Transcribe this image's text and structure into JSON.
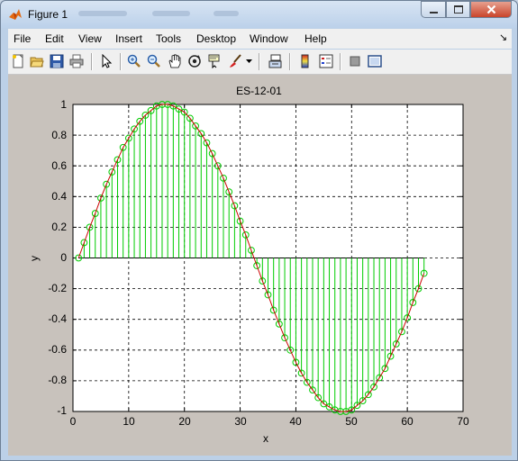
{
  "window": {
    "title": "Figure 1",
    "controls": {
      "minimize": "minimize",
      "maximize": "maximize",
      "close": "close"
    }
  },
  "menu": [
    "File",
    "Edit",
    "View",
    "Insert",
    "Tools",
    "Desktop",
    "Window",
    "Help"
  ],
  "toolbar": [
    {
      "name": "new-figure-icon"
    },
    {
      "name": "open-file-icon"
    },
    {
      "name": "save-icon"
    },
    {
      "name": "print-icon"
    },
    {
      "name": "edit-plot-arrow-icon"
    },
    {
      "name": "zoom-in-icon"
    },
    {
      "name": "zoom-out-icon"
    },
    {
      "name": "pan-hand-icon"
    },
    {
      "name": "rotate-3d-icon"
    },
    {
      "name": "data-cursor-icon"
    },
    {
      "name": "brush-icon"
    },
    {
      "name": "link-plot-icon"
    },
    {
      "name": "colorbar-icon"
    },
    {
      "name": "legend-icon"
    },
    {
      "name": "hide-plot-tools-icon"
    },
    {
      "name": "show-plot-tools-icon"
    }
  ],
  "chart_data": {
    "type": "line",
    "title": "ES-12-01",
    "xlabel": "x",
    "ylabel": "y",
    "xlim": [
      0,
      70
    ],
    "ylim": [
      -1,
      1
    ],
    "xticks": [
      "0",
      "10",
      "20",
      "30",
      "40",
      "50",
      "60",
      "70"
    ],
    "yticks": [
      "1",
      "0.8",
      "0.6",
      "0.4",
      "0.2",
      "0",
      "-0.2",
      "-0.4",
      "-0.6",
      "-0.8",
      "-1"
    ],
    "grid": true,
    "series": [
      {
        "style": "stem",
        "color": "#00cc00",
        "marker": "circle",
        "x": [
          1,
          2,
          3,
          4,
          5,
          6,
          7,
          8,
          9,
          10,
          11,
          12,
          13,
          14,
          15,
          16,
          17,
          18,
          19,
          20,
          21,
          22,
          23,
          24,
          25,
          26,
          27,
          28,
          29,
          30,
          31,
          32,
          33,
          34,
          35,
          36,
          37,
          38,
          39,
          40,
          41,
          42,
          43,
          44,
          45,
          46,
          47,
          48,
          49,
          50,
          51,
          52,
          53,
          54,
          55,
          56,
          57,
          58,
          59,
          60,
          61,
          62,
          63
        ],
        "y": [
          0.0,
          0.1,
          0.2,
          0.29,
          0.39,
          0.48,
          0.56,
          0.64,
          0.72,
          0.78,
          0.84,
          0.89,
          0.93,
          0.96,
          0.99,
          1.0,
          1.0,
          0.99,
          0.97,
          0.95,
          0.91,
          0.86,
          0.81,
          0.75,
          0.68,
          0.6,
          0.52,
          0.43,
          0.34,
          0.24,
          0.15,
          0.05,
          -0.05,
          -0.15,
          -0.24,
          -0.34,
          -0.43,
          -0.52,
          -0.6,
          -0.68,
          -0.75,
          -0.81,
          -0.86,
          -0.91,
          -0.95,
          -0.97,
          -0.99,
          -1.0,
          -1.0,
          -0.99,
          -0.96,
          -0.93,
          -0.89,
          -0.84,
          -0.78,
          -0.72,
          -0.64,
          -0.56,
          -0.48,
          -0.39,
          -0.29,
          -0.2,
          -0.1
        ]
      },
      {
        "style": "line",
        "color": "#cc0000",
        "x": [
          1,
          2,
          3,
          4,
          5,
          6,
          7,
          8,
          9,
          10,
          11,
          12,
          13,
          14,
          15,
          16,
          17,
          18,
          19,
          20,
          21,
          22,
          23,
          24,
          25,
          26,
          27,
          28,
          29,
          30,
          31,
          32,
          33,
          34,
          35,
          36,
          37,
          38,
          39,
          40,
          41,
          42,
          43,
          44,
          45,
          46,
          47,
          48,
          49,
          50,
          51,
          52,
          53,
          54,
          55,
          56,
          57,
          58,
          59,
          60,
          61,
          62,
          63
        ],
        "y": [
          0.0,
          0.1,
          0.2,
          0.29,
          0.39,
          0.48,
          0.56,
          0.64,
          0.72,
          0.78,
          0.84,
          0.89,
          0.93,
          0.96,
          0.99,
          1.0,
          1.0,
          0.99,
          0.97,
          0.95,
          0.91,
          0.86,
          0.81,
          0.75,
          0.68,
          0.6,
          0.52,
          0.43,
          0.34,
          0.24,
          0.15,
          0.05,
          -0.05,
          -0.15,
          -0.24,
          -0.34,
          -0.43,
          -0.52,
          -0.6,
          -0.68,
          -0.75,
          -0.81,
          -0.86,
          -0.91,
          -0.95,
          -0.97,
          -0.99,
          -1.0,
          -1.0,
          -0.99,
          -0.96,
          -0.93,
          -0.89,
          -0.84,
          -0.78,
          -0.72,
          -0.64,
          -0.56,
          -0.48,
          -0.39,
          -0.29,
          -0.2,
          -0.1
        ]
      }
    ]
  }
}
